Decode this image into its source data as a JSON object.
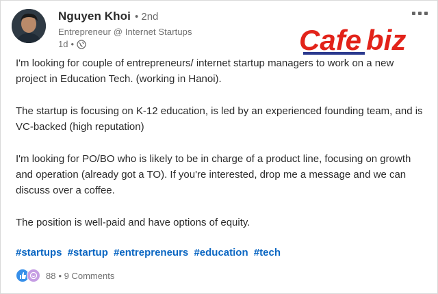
{
  "post": {
    "author": {
      "name": "Nguyen Khoi",
      "degree": "• 2nd",
      "headline": "Entrepreneur @ Internet Startups",
      "time": "1d",
      "time_sep": "•",
      "visibility_icon": "globe-icon"
    },
    "watermark": {
      "text": "CafeBiz",
      "brand_color": "#e2231a",
      "accent_color": "#2b3a8f"
    },
    "body": {
      "p1": "I'm looking for couple of entrepreneurs/ internet startup managers to work on a new project in Education Tech. (working in Hanoi).",
      "p2": "The startup is focusing on K-12 education, is led by an experienced founding team, and is VC-backed (high reputation)",
      "p3": "I'm looking for PO/BO who is likely to be in charge of a product line, focusing on growth and operation (already got a TO). If you're interested, drop me a message and we can discuss over a coffee.",
      "p4": "The position is well-paid and have options of equity."
    },
    "hashtags": [
      "#startups",
      "#startup",
      "#entrepreneurs",
      "#education",
      "#tech"
    ],
    "social": {
      "reaction_icons": [
        "like-icon",
        "support-icon"
      ],
      "reaction_count": "88",
      "comments": "• 9 Comments"
    }
  },
  "colors": {
    "link": "#0a66c2",
    "like": "#378fe9",
    "support": "#c59de3"
  }
}
